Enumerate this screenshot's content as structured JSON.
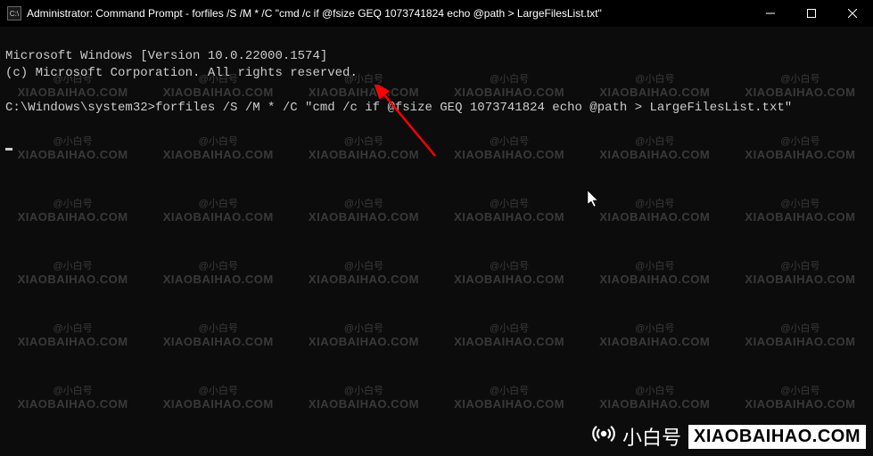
{
  "titlebar": {
    "icon_label": "C:\\",
    "title": "Administrator: Command Prompt - forfiles  /S /M * /C \"cmd /c if @fsize GEQ 1073741824 echo @path > LargeFilesList.txt\""
  },
  "terminal": {
    "line1": "Microsoft Windows [Version 10.0.22000.1574]",
    "line2": "(c) Microsoft Corporation. All rights reserved.",
    "blank": "",
    "prompt": "C:\\Windows\\system32>",
    "command": "forfiles /S /M * /C \"cmd /c if @fsize GEQ 1073741824 echo @path > LargeFilesList.txt\""
  },
  "watermark": {
    "small": "@小白号",
    "big": "XIAOBAIHAO.COM"
  },
  "bottom_logo": {
    "text": "小白号",
    "url": "XIAOBAIHAO.COM"
  },
  "annotations": {
    "arrow_color": "#ff0000"
  }
}
